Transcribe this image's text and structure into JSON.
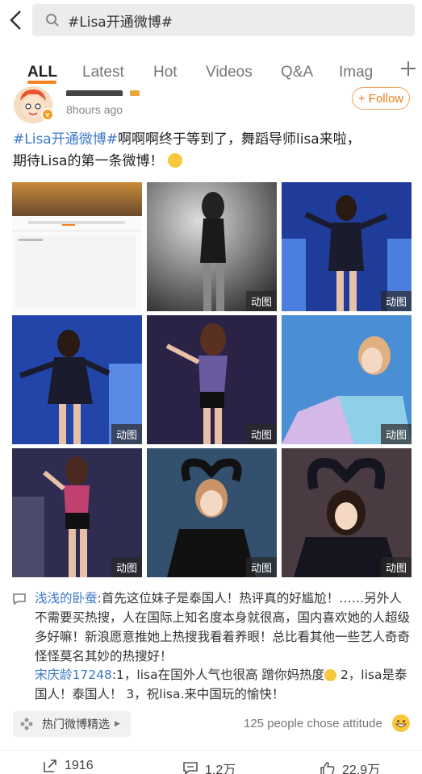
{
  "search": {
    "query": "#Lisa开通微博#"
  },
  "tabs": [
    {
      "label": "ALL"
    },
    {
      "label": "Latest"
    },
    {
      "label": "Hot"
    },
    {
      "label": "Videos"
    },
    {
      "label": "Q&A"
    },
    {
      "label": "Imag"
    }
  ],
  "post": {
    "time": "8hours ago",
    "follow_label": "+ Follow",
    "hashtag": "#Lisa开通微博#",
    "text_line1": "啊啊啊终于等到了，舞蹈导师lisa来啦，",
    "text_line2": "期待Lisa的第一条微博！",
    "gif_label": "动图"
  },
  "comments": [
    {
      "user": "浅浅的卧蚕",
      "text": ":首先这位妹子是泰国人！热评真的好尴尬！……另外人不需要买热搜，人在国际上知名度本身就很高，国内喜欢她的人超级多好嘛！新浪愿意推她上热搜我看着养眼！总比看其他一些艺人奇奇怪怪莫名其妙的热搜好！"
    },
    {
      "user": "宋庆龄17248",
      "text_a": ":1，lisa在国外人气也很高 蹭你妈热度",
      "text_b": " 2，lisa是泰国人！泰国人！ 3，祝lisa.来中国玩的愉快！"
    }
  ],
  "hot": {
    "label": "热门微博精选"
  },
  "attitude": {
    "text": "125 people chose attitude"
  },
  "footer": {
    "reposts": "1916",
    "comments": "1.2万",
    "likes": "22.9万"
  },
  "colors": {
    "accent": "#f58220",
    "link": "#3d78c8"
  }
}
